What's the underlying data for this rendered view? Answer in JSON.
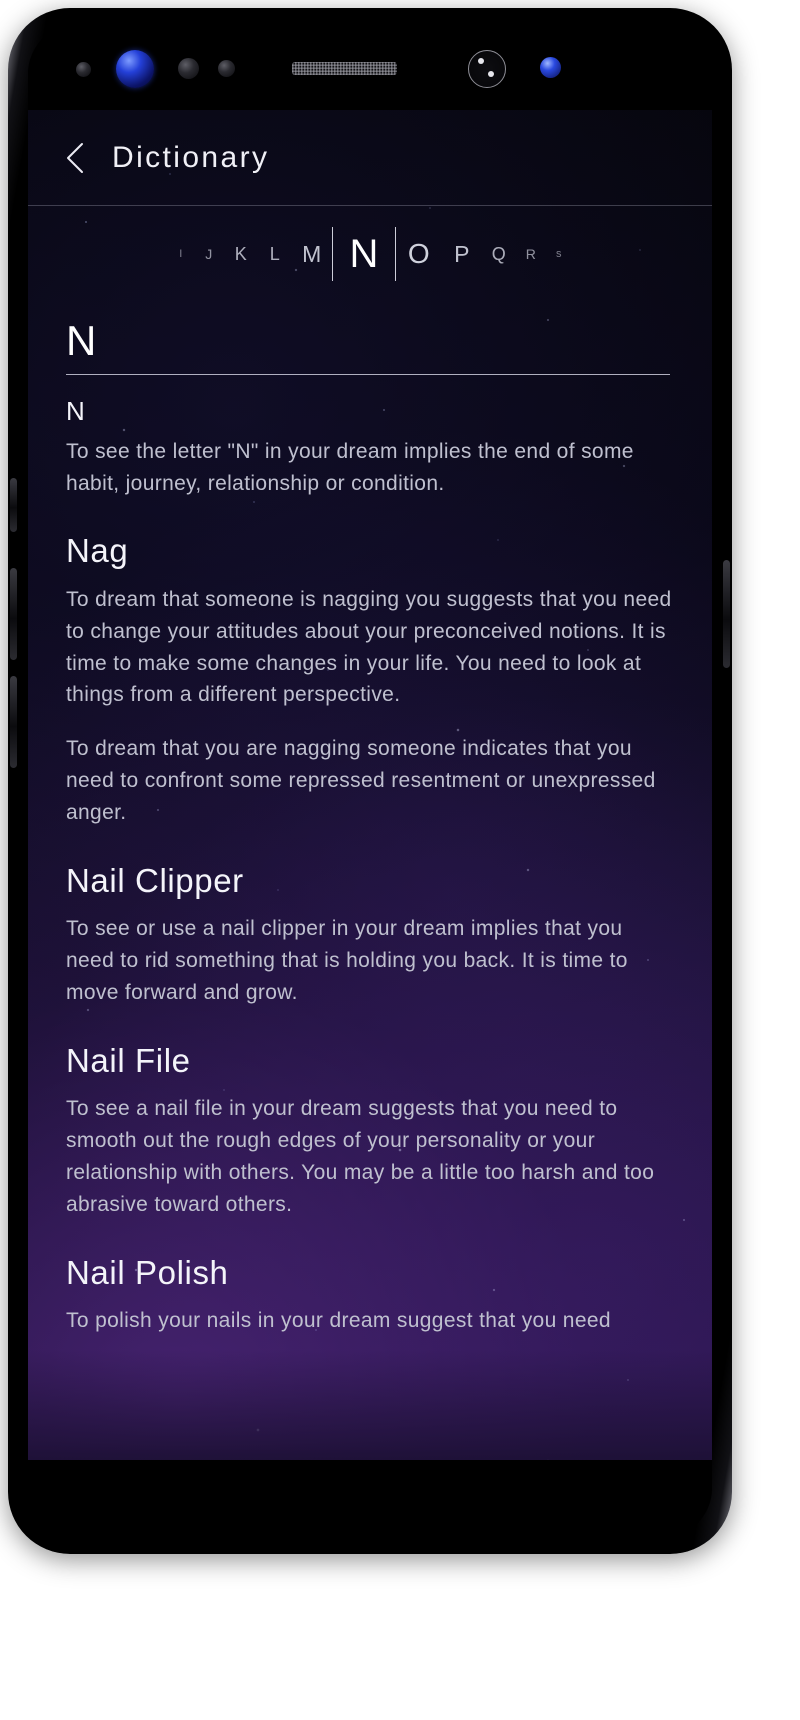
{
  "device": {
    "sensors": [
      "proximity-sensor",
      "front-camera",
      "iris-sensor",
      "light-sensor",
      "earpiece-speaker",
      "face-sensor",
      "secondary-camera"
    ]
  },
  "header": {
    "back_icon": "chevron-left-icon",
    "title": "Dictionary"
  },
  "alphabet": {
    "selected": "N",
    "items": [
      {
        "label": "I",
        "size": "a-xxs"
      },
      {
        "label": "J",
        "size": "a-xs"
      },
      {
        "label": "K",
        "size": "a-s"
      },
      {
        "label": "L",
        "size": "a-s"
      },
      {
        "label": "M",
        "size": "a-m"
      },
      {
        "label": "N",
        "size": "a-sel"
      },
      {
        "label": "O",
        "size": "a-l"
      },
      {
        "label": "P",
        "size": "a-m"
      },
      {
        "label": "Q",
        "size": "a-s"
      },
      {
        "label": "R",
        "size": "a-xs"
      },
      {
        "label": "s",
        "size": "a-xxs"
      }
    ]
  },
  "section": {
    "letter": "N"
  },
  "entries": [
    {
      "term": "N",
      "paragraphs": [
        "To see the letter \"N\" in your dream implies the end of some habit, journey, relationship or condition."
      ]
    },
    {
      "term": "Nag",
      "paragraphs": [
        "To dream that someone is nagging you suggests that you need to change your attitudes about your preconceived notions. It is time to make some changes in your life. You need to look at things from a different perspective.",
        "To dream that you are nagging someone indicates that you need to confront some repressed resentment or unexpressed anger."
      ]
    },
    {
      "term": "Nail Clipper",
      "paragraphs": [
        "To see or use a nail clipper in your dream implies that you need to rid something that is holding you back. It is time to move forward and grow."
      ]
    },
    {
      "term": "Nail File",
      "paragraphs": [
        "To see a nail file in your dream suggests that you need to smooth out the rough edges of your personality or your relationship with others. You may be a little too harsh and too abrasive toward others."
      ]
    },
    {
      "term": "Nail Polish",
      "paragraphs": [
        "To polish your nails in your dream suggest that you need"
      ]
    }
  ],
  "colors": {
    "screen_top": "#06060d",
    "screen_bottom": "#271548",
    "text_primary": "#f4f4fa",
    "text_body": "#bfc0cf",
    "accent_blue": "#2440d8"
  }
}
